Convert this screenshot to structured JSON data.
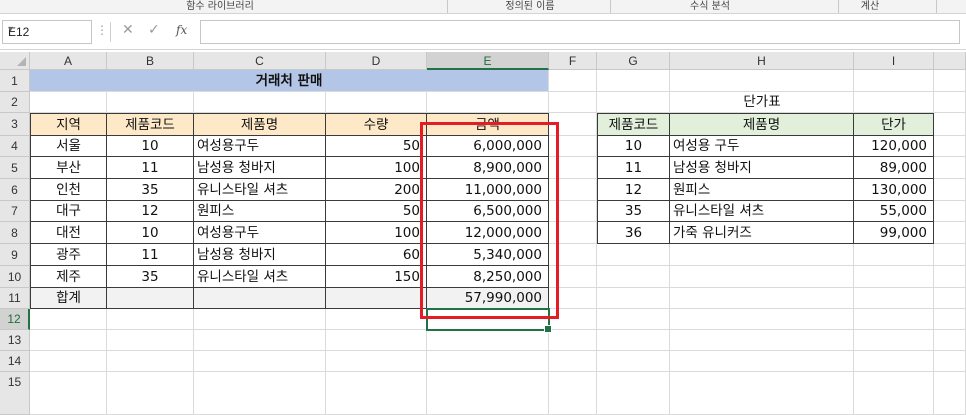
{
  "ribbon": {
    "groups": [
      {
        "label": "함수 라이브러리"
      },
      {
        "label": "정의된 이름"
      },
      {
        "label": "수식 분석"
      },
      {
        "label": "계산"
      }
    ]
  },
  "formula_bar": {
    "name_box": "E12",
    "cancel_symbol": "✕",
    "enter_symbol": "✓",
    "fx_symbol": "fx",
    "formula": ""
  },
  "columns": [
    "A",
    "B",
    "C",
    "D",
    "E",
    "F",
    "G",
    "H",
    "I"
  ],
  "rows": [
    "1",
    "2",
    "3",
    "4",
    "5",
    "6",
    "7",
    "8",
    "9",
    "10",
    "11",
    "12",
    "13",
    "14",
    "15"
  ],
  "active_cell": "E12",
  "sales_table": {
    "title": "거래처 판매",
    "headers": [
      "지역",
      "제품코드",
      "제품명",
      "수량",
      "금액"
    ],
    "rows": [
      [
        "서울",
        "10",
        "여성용구두",
        "50",
        "6,000,000"
      ],
      [
        "부산",
        "11",
        "남성용 청바지",
        "100",
        "8,900,000"
      ],
      [
        "인천",
        "35",
        "유니스타일 셔츠",
        "200",
        "11,000,000"
      ],
      [
        "대구",
        "12",
        "원피스",
        "50",
        "6,500,000"
      ],
      [
        "대전",
        "10",
        "여성용구두",
        "100",
        "12,000,000"
      ],
      [
        "광주",
        "11",
        "남성용 청바지",
        "60",
        "5,340,000"
      ],
      [
        "제주",
        "35",
        "유니스타일 셔츠",
        "150",
        "8,250,000"
      ]
    ],
    "total_label": "합계",
    "total_value": "57,990,000"
  },
  "price_table": {
    "title": "단가표",
    "headers": [
      "제품코드",
      "제품명",
      "단가"
    ],
    "rows": [
      [
        "10",
        "여성용 구두",
        "120,000"
      ],
      [
        "11",
        "남성용 청바지",
        "89,000"
      ],
      [
        "12",
        "원피스",
        "130,000"
      ],
      [
        "35",
        "유니스타일 셔츠",
        "55,000"
      ],
      [
        "36",
        "가죽 유니커즈",
        "99,000"
      ]
    ]
  },
  "colors": {
    "title_fill": "#b4c6e7",
    "sales_header_fill": "#fde9c8",
    "price_header_fill": "#e2efda",
    "total_fill": "#f2f2f2",
    "highlight_box": "#e51c23",
    "selection": "#217346"
  }
}
